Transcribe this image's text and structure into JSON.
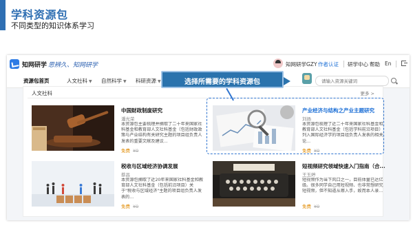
{
  "slide": {
    "title": "学科资源包",
    "subtitle": "不同类型的知识体系学习"
  },
  "topbar": {
    "logo": "知网研学",
    "slogan": "思辨久、知网研学",
    "user_name": "知网研学GZY",
    "links": [
      "作者认证",
      "研学中心",
      "帮助",
      "En"
    ]
  },
  "navbar": {
    "items": [
      {
        "label": "资源包首页",
        "active": true,
        "dropdown": false
      },
      {
        "label": "人文社科",
        "active": false,
        "dropdown": true
      },
      {
        "label": "自然科学",
        "active": false,
        "dropdown": true
      },
      {
        "label": "科研资源",
        "active": false,
        "dropdown": true
      }
    ],
    "search_placeholder": "请输入资源关键词"
  },
  "callout": {
    "text": "选择所需要的学科资源包"
  },
  "section": {
    "title": "人文社科",
    "more": "更多 >"
  },
  "cards": [
    {
      "title": "中国财政制度研究",
      "author": "潘光荣",
      "desc": "本资源包主要梳理并摘取了二十年来国家社科基金和教育部人文社科基金（包括财政政策与产业结构有关研究主题的项目组负责人发表的重要文献及建议...",
      "free": "免费",
      "orig_price": "¥0"
    },
    {
      "title": "产业经济与结构之产业主题研究",
      "author": "刘扬",
      "desc": "本资源包梳理了近二十年来国家社科基金和教育部人文社科基金（包括学科前沿项目）列入国际经济学的项目组负责人发表的相关论...",
      "free": "免费",
      "orig_price": "¥0"
    },
    {
      "title": "税收与区域经济协调发展",
      "author": "蔡昌",
      "desc": "本资源包摘取了近20年来国家社科基金和教育部人文社科基金（包括前沿项目）关于\"税收与区域经济\"主题的项目组负责人发表的...",
      "free": "免费",
      "orig_price": "¥0"
    },
    {
      "title": "短视频研究领域快速入门指南（合...",
      "author": "王玉婷",
      "desc": "短视频作为当下风口之一，目前体量已达亿级。很多同学自己用短视频、也非常想研究短视频，但不知道从哪入手，故而本人录...",
      "free": "免费",
      "orig_price": "¥0"
    }
  ],
  "colors": {
    "brand": "#2f6fb3",
    "link": "#1c6fd6",
    "free": "#e08a00",
    "callout": "#2b73ad"
  }
}
